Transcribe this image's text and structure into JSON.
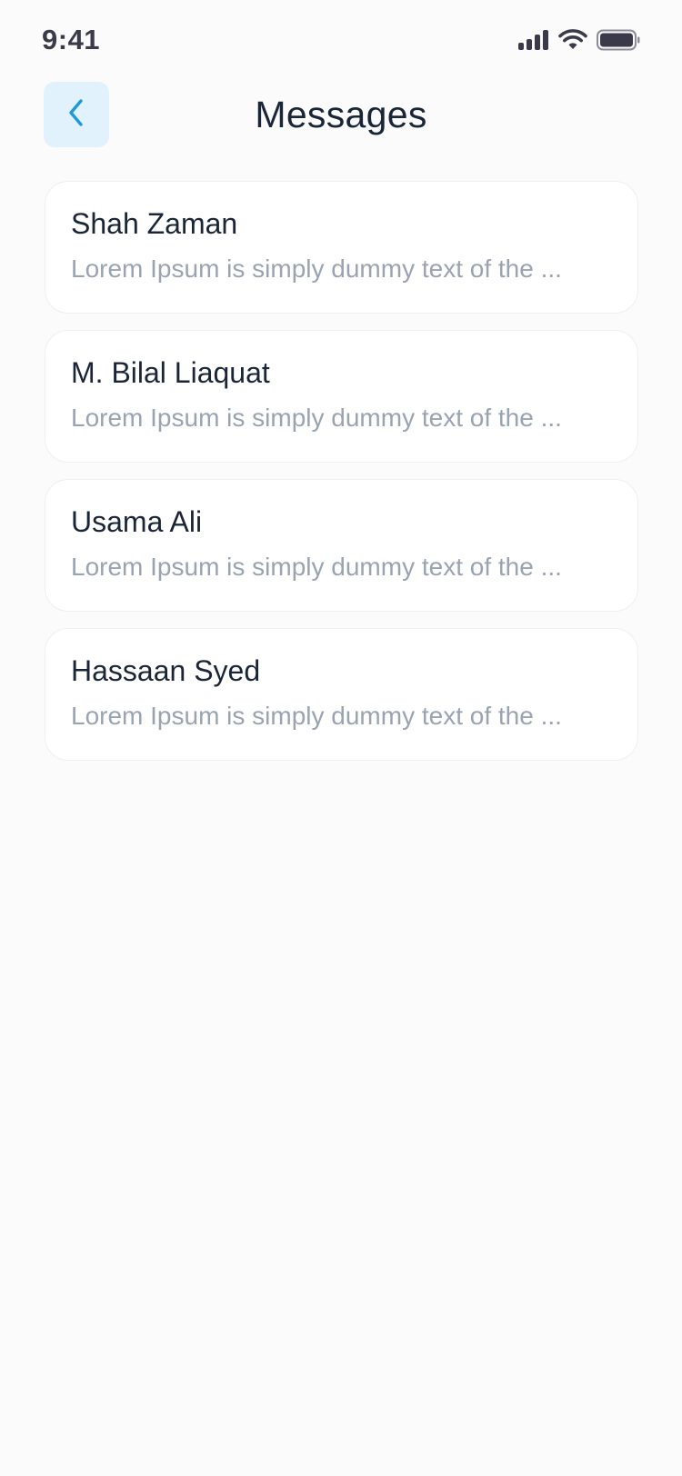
{
  "status_bar": {
    "time": "9:41",
    "icons": [
      "cellular-signal-icon",
      "wifi-icon",
      "battery-icon"
    ]
  },
  "header": {
    "title": "Messages",
    "back_icon": "chevron-left-icon"
  },
  "messages": [
    {
      "name": "Shah Zaman",
      "preview": "Lorem Ipsum is simply dummy text of the ..."
    },
    {
      "name": "M. Bilal Liaquat",
      "preview": "Lorem Ipsum is simply dummy text of the ..."
    },
    {
      "name": "Usama Ali",
      "preview": "Lorem Ipsum is simply dummy text of the ..."
    },
    {
      "name": "Hassaan Syed",
      "preview": "Lorem Ipsum is simply dummy text of the ..."
    }
  ],
  "colors": {
    "background": "#fbfbfb",
    "accent": "#1d9ad9",
    "back_button_bg": "#e1f2fd",
    "title_text": "#1b2538",
    "preview_text": "#9aa3b2",
    "status_icons": "#3b3a4a"
  }
}
